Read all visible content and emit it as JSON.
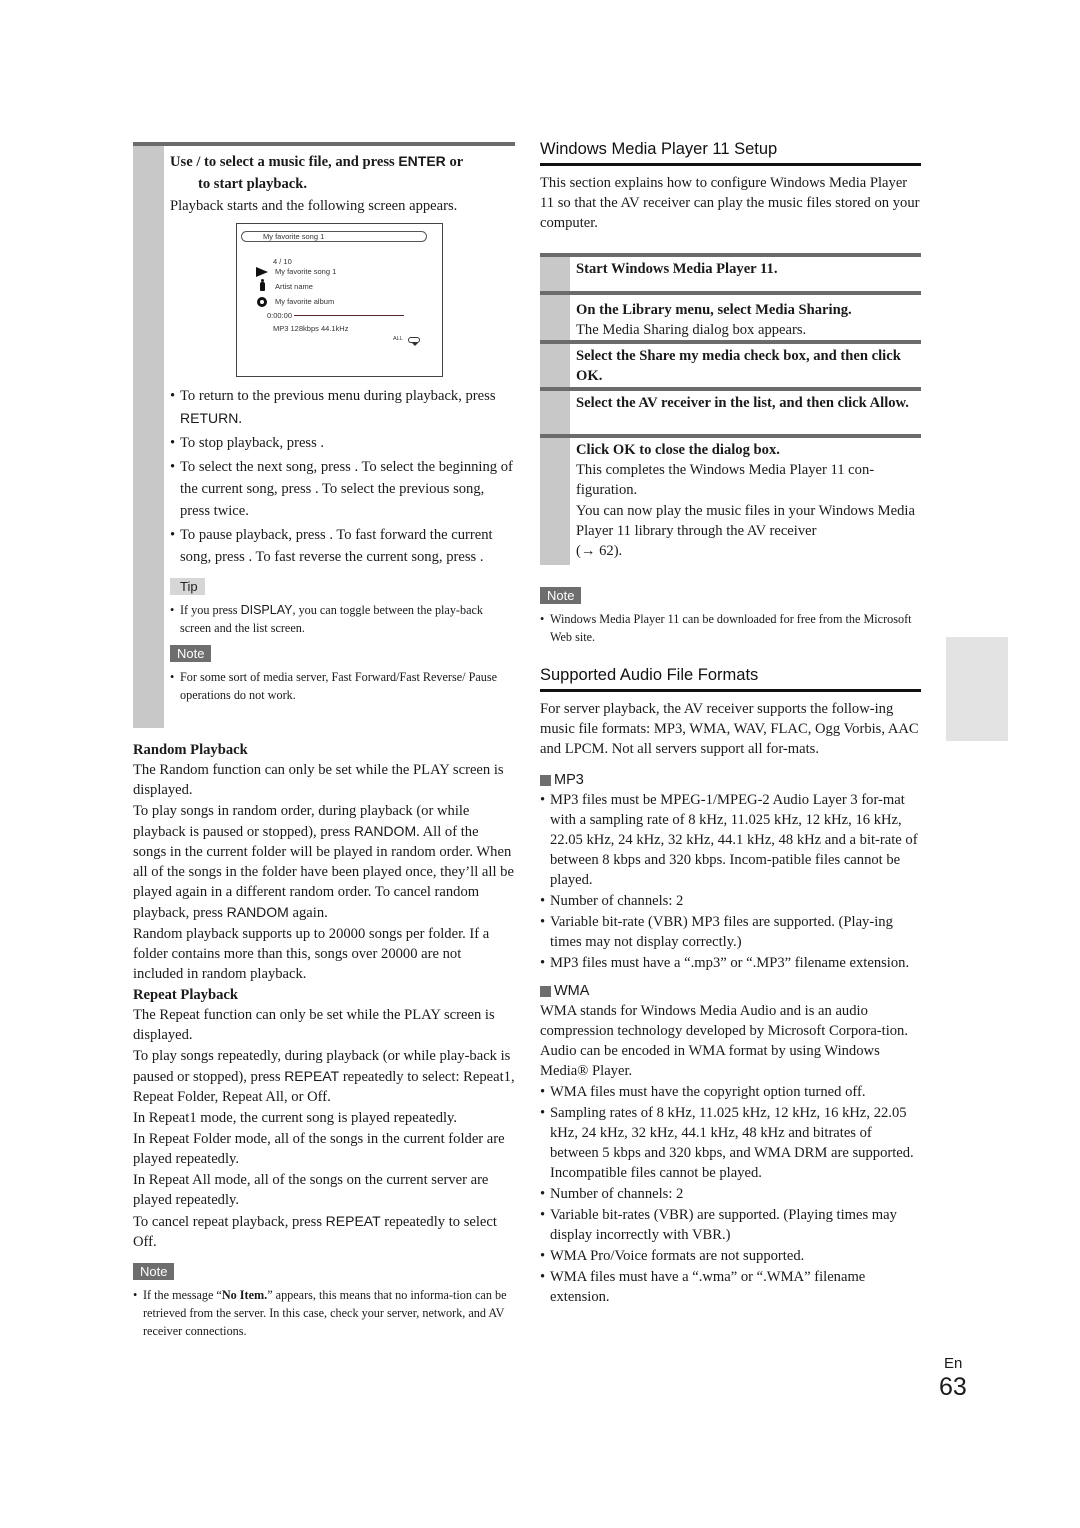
{
  "left": {
    "step": {
      "title_part1": "Use    /    to select a music file, and press ",
      "title_key": "ENTER",
      "title_part2": " or",
      "title_line2": "to start playback.",
      "body": "Playback starts and the following screen appears."
    },
    "play_screen": {
      "title": "My favorite song 1",
      "count": "4 / 10",
      "song": "My favorite song 1",
      "artist": "Artist name",
      "album": "My favorite album",
      "time": "0:00:00",
      "format": "MP3 128kbps 44.1kHz",
      "repeat_mode": "ALL",
      "icons": {
        "song": "play-icon",
        "artist": "person-icon",
        "album": "disc-icon",
        "repeat": "repeat-icon"
      }
    },
    "bullets": [
      {
        "pre": "To return to the previous menu during playback, press ",
        "key": "RETURN",
        "post": "."
      },
      {
        "pre": "To stop playback, press     .",
        "key": "",
        "post": ""
      },
      {
        "pre": "To select the next song, press        . To select the beginning of the current song, press        . To select the previous song, press        twice.",
        "key": "",
        "post": ""
      },
      {
        "pre": "To pause playback, press     . To fast forward the current song, press        . To fast reverse the current song, press        .",
        "key": "",
        "post": ""
      }
    ],
    "tip": {
      "label": "Tip",
      "pre": "If you press ",
      "key": "DISPLAY",
      "post": ", you can toggle between the play-back screen and the list screen."
    },
    "note1": {
      "label": "Note",
      "text": "For some sort of media server, Fast Forward/Fast Reverse/ Pause operations do not work."
    },
    "random": {
      "heading": "Random Playback",
      "p1": "The Random function can only be set while the PLAY screen is displayed.",
      "p2_pre": "To play songs in random order, during playback (or while playback is paused or stopped), press ",
      "p2_key": "RANDOM",
      "p2_mid": ". All of the songs in the current folder will be played in random order. When all of the songs in the folder have been played once, they’ll all be played again in a different random order. To cancel random playback, press ",
      "p2_key2": "RANDOM",
      "p2_post": " again.",
      "p3": "Random playback supports up to 20000 songs per folder. If a folder contains more than this, songs over 20000 are not included in random playback."
    },
    "repeat": {
      "heading": "Repeat Playback",
      "p1": "The Repeat function can only be set while the PLAY screen is displayed.",
      "p2_pre": "To play songs repeatedly, during playback (or while play-back is paused or stopped), press ",
      "p2_key": "REPEAT",
      "p2_post": " repeatedly to select: Repeat1, Repeat Folder, Repeat All, or Off.",
      "p3": "In Repeat1 mode, the current song is played repeatedly.",
      "p4": "In Repeat Folder mode, all of the songs in the current folder are played repeatedly.",
      "p5": "In Repeat All mode, all of the songs on the current server are played repeatedly.",
      "p6_pre": "To cancel repeat playback, press ",
      "p6_key": "REPEAT",
      "p6_post": " repeatedly to select Off."
    },
    "note2": {
      "label": "Note",
      "pre": "If the message “",
      "bold": "No Item.",
      "post": "” appears, this means that no informa-tion can be retrieved from the server. In this case, check your server, network, and AV receiver connections."
    }
  },
  "right": {
    "wmp": {
      "heading": "Windows Media Player 11 Setup",
      "intro": "This section explains how to configure Windows Media Player 11 so that the AV receiver can play the music files stored on your computer.",
      "steps": [
        {
          "title": "Start Windows Media Player 11.",
          "body": []
        },
        {
          "title": "On the Library menu, select Media Sharing.",
          "body": [
            "The Media Sharing dialog box appears."
          ]
        },
        {
          "title": "Select the Share my media check box, and then click OK.",
          "body": []
        },
        {
          "title": "Select the AV receiver in the list, and then click Allow.",
          "body": []
        },
        {
          "title": "Click OK to close the dialog box.",
          "body": [
            "This completes the Windows Media Player 11 con-figuration.",
            "You can now play the music files in your Windows Media Player 11 library through the AV receiver"
          ]
        }
      ],
      "xref": "(→ 62).",
      "note_label": "Note",
      "note": "Windows Media Player 11 can be downloaded for free from the Microsoft Web site."
    },
    "formats": {
      "heading": "Supported Audio File Formats",
      "intro": "For server playback, the AV receiver supports the follow-ing music file formats: MP3, WMA, WAV, FLAC, Ogg Vorbis, AAC and LPCM. Not all servers support all for-mats.",
      "mp3": {
        "heading": "MP3",
        "bullets": [
          "MP3 files must be MPEG-1/MPEG-2 Audio Layer 3 for-mat with a sampling rate of 8 kHz, 11.025 kHz, 12 kHz, 16 kHz, 22.05 kHz, 24 kHz, 32 kHz, 44.1 kHz, 48 kHz and a bit-rate of between 8 kbps and 320 kbps. Incom-patible files cannot be played.",
          "Number of channels: 2",
          "Variable bit-rate (VBR) MP3 files are supported. (Play-ing times may not display correctly.)",
          "MP3 files must have a “.mp3” or “.MP3” filename extension."
        ]
      },
      "wma": {
        "heading": "WMA",
        "intro": "WMA stands for Windows Media Audio and is an audio compression technology developed by Microsoft Corpora-tion. Audio can be encoded in WMA format by using Windows Media® Player.",
        "bullets": [
          "WMA files must have the copyright option turned off.",
          "Sampling rates of 8 kHz, 11.025 kHz, 12 kHz, 16 kHz, 22.05 kHz, 24 kHz, 32 kHz, 44.1 kHz, 48 kHz and bitrates of between 5 kbps and 320 kbps, and WMA DRM are supported. Incompatible files cannot be played.",
          "Number of channels: 2",
          "Variable bit-rates (VBR) are supported. (Playing times may display incorrectly with VBR.)",
          "WMA Pro/Voice formats are not supported.",
          "WMA files must have a “.wma” or “.WMA” filename extension."
        ]
      }
    }
  },
  "footer": {
    "lang": "En",
    "page": "63"
  },
  "colors": {
    "step_bar": "#c8c8c8",
    "step_rule": "#6b6b6b",
    "note_label_bg": "#6e6e6e",
    "tip_label_bg": "#d6d6d6",
    "side_tab": "#e3e3e3"
  }
}
